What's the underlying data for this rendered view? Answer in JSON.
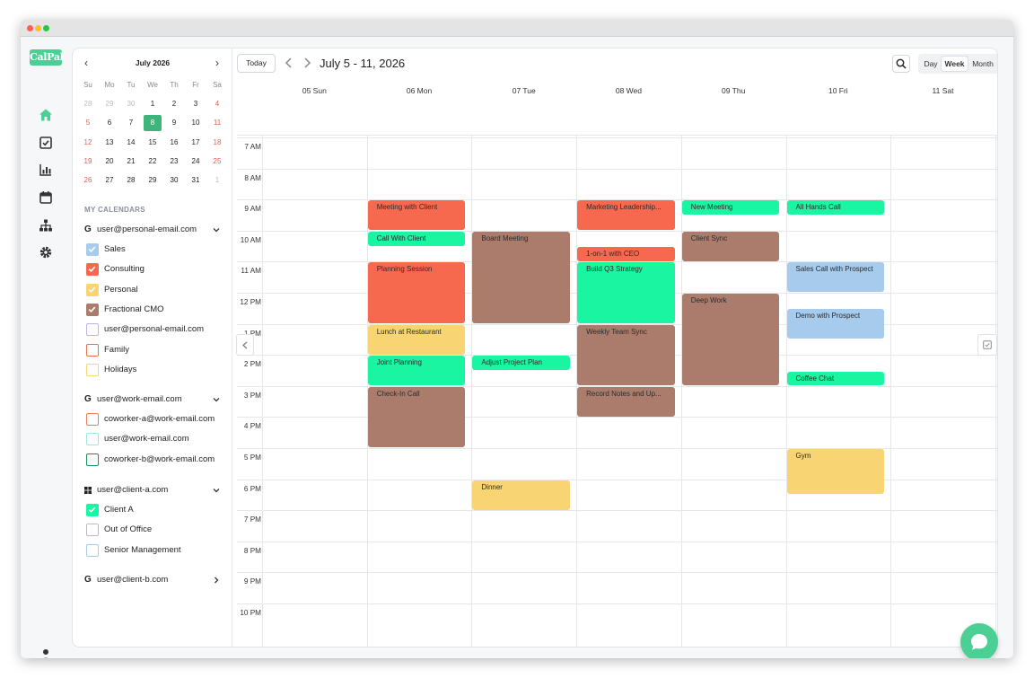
{
  "brand": {
    "logo_text": "CalPal",
    "accent": "#4ccf95"
  },
  "mini_calendar": {
    "month_label": "July 2026",
    "weekdays": [
      "Su",
      "Mo",
      "Tu",
      "We",
      "Th",
      "Fr",
      "Sa"
    ],
    "weeks": [
      [
        "28",
        "29",
        "30",
        "1",
        "2",
        "3",
        "4"
      ],
      [
        "5",
        "6",
        "7",
        "8",
        "9",
        "10",
        "11"
      ],
      [
        "12",
        "13",
        "14",
        "15",
        "16",
        "17",
        "18"
      ],
      [
        "19",
        "20",
        "21",
        "22",
        "23",
        "24",
        "25"
      ],
      [
        "26",
        "27",
        "28",
        "29",
        "30",
        "31",
        "1"
      ]
    ],
    "selected_day": "8"
  },
  "calendars": {
    "section_label": "MY CALENDARS",
    "accounts": [
      {
        "brand_icon": "google-icon",
        "brand_glyph": "G",
        "name": "user@personal-email.com",
        "expanded": true,
        "items": [
          {
            "label": "Sales",
            "checked": true,
            "color": "#a6cbec"
          },
          {
            "label": "Consulting",
            "checked": true,
            "color": "#f7694f"
          },
          {
            "label": "Personal",
            "checked": true,
            "color": "#f9d472"
          },
          {
            "label": "Fractional CMO",
            "checked": true,
            "color": "#ab7c6c"
          },
          {
            "label": "user@personal-email.com",
            "checked": false,
            "color": "#b9b4f0"
          },
          {
            "label": "Family",
            "checked": false,
            "color": "#f06b55"
          },
          {
            "label": "Holidays",
            "checked": false,
            "color": "#f9d472"
          }
        ]
      },
      {
        "brand_icon": "google-icon",
        "brand_glyph": "G",
        "name": "user@work-email.com",
        "expanded": true,
        "items": [
          {
            "label": "coworker-a@work-email.com",
            "checked": false,
            "color": "#f07a5e"
          },
          {
            "label": "user@work-email.com",
            "checked": false,
            "color": "#9fe6e3"
          },
          {
            "label": "coworker-b@work-email.com",
            "checked": false,
            "color": "#1e8f52"
          }
        ]
      },
      {
        "brand_icon": "windows-icon",
        "brand_glyph": "",
        "name": "user@client-a.com",
        "expanded": true,
        "items": [
          {
            "label": "Client A",
            "checked": true,
            "color": "#19f5a1"
          },
          {
            "label": "Out of Office",
            "checked": false,
            "color": "#b8bcc2"
          },
          {
            "label": "Senior Management",
            "checked": false,
            "color": "#a6cbec"
          }
        ]
      },
      {
        "brand_icon": "google-icon",
        "brand_glyph": "G",
        "name": "user@client-b.com",
        "expanded": false,
        "items": []
      }
    ]
  },
  "toolbar": {
    "today_label": "Today",
    "range_title": "July 5 - 11, 2026",
    "views": [
      "Day",
      "Week",
      "Month"
    ],
    "active_view": "Week"
  },
  "week": {
    "days": [
      "05 Sun",
      "06 Mon",
      "07 Tue",
      "08 Wed",
      "09 Thu",
      "10 Fri",
      "11 Sat"
    ],
    "hours": [
      "7 AM",
      "8 AM",
      "9 AM",
      "10 AM",
      "11 AM",
      "12 PM",
      "1 PM",
      "2 PM",
      "3 PM",
      "4 PM",
      "5 PM",
      "6 PM",
      "7 PM",
      "8 PM",
      "9 PM",
      "10 PM"
    ],
    "first_hour": 7
  },
  "events": [
    {
      "title": "Meeting with Client",
      "day": 1,
      "start": 9.0,
      "end": 10.0,
      "color": "red"
    },
    {
      "title": "Call With Client",
      "day": 1,
      "start": 10.0,
      "end": 10.5,
      "color": "green"
    },
    {
      "title": "Planning Session",
      "day": 1,
      "start": 11.0,
      "end": 13.0,
      "color": "red"
    },
    {
      "title": "Lunch at Restaurant",
      "day": 1,
      "start": 13.0,
      "end": 14.0,
      "color": "yellow"
    },
    {
      "title": "Joint Planning",
      "day": 1,
      "start": 14.0,
      "end": 15.0,
      "color": "green"
    },
    {
      "title": "Check-In Call",
      "day": 1,
      "start": 15.0,
      "end": 17.0,
      "color": "brown"
    },
    {
      "title": "Board Meeting",
      "day": 2,
      "start": 10.0,
      "end": 13.0,
      "color": "brown"
    },
    {
      "title": "Adjust Project Plan",
      "day": 2,
      "start": 14.0,
      "end": 14.5,
      "color": "green"
    },
    {
      "title": "Dinner",
      "day": 2,
      "start": 18.0,
      "end": 19.0,
      "color": "yellow"
    },
    {
      "title": "Marketing Leadership...",
      "day": 3,
      "start": 9.0,
      "end": 10.0,
      "color": "red"
    },
    {
      "title": "1-on-1 with CEO",
      "day": 3,
      "start": 10.5,
      "end": 11.0,
      "color": "red"
    },
    {
      "title": "Build Q3 Strategy",
      "day": 3,
      "start": 11.0,
      "end": 13.0,
      "color": "green"
    },
    {
      "title": "Weekly Team Sync",
      "day": 3,
      "start": 13.0,
      "end": 15.0,
      "color": "brown"
    },
    {
      "title": "Record Notes and Up...",
      "day": 3,
      "start": 15.0,
      "end": 16.0,
      "color": "brown"
    },
    {
      "title": "New Meeting",
      "day": 4,
      "start": 9.0,
      "end": 9.5,
      "color": "green"
    },
    {
      "title": "Client Sync",
      "day": 4,
      "start": 10.0,
      "end": 11.0,
      "color": "brown"
    },
    {
      "title": "Deep Work",
      "day": 4,
      "start": 12.0,
      "end": 15.0,
      "color": "brown"
    },
    {
      "title": "All Hands Call",
      "day": 5,
      "start": 9.0,
      "end": 9.5,
      "color": "green"
    },
    {
      "title": "Sales Call with Prospect",
      "day": 5,
      "start": 11.0,
      "end": 12.0,
      "color": "blue"
    },
    {
      "title": "Demo with Prospect",
      "day": 5,
      "start": 12.5,
      "end": 13.5,
      "color": "blue"
    },
    {
      "title": "Coffee Chat",
      "day": 5,
      "start": 14.5,
      "end": 15.0,
      "color": "green"
    },
    {
      "title": "Gym",
      "day": 5,
      "start": 17.0,
      "end": 18.5,
      "color": "yellow"
    }
  ]
}
